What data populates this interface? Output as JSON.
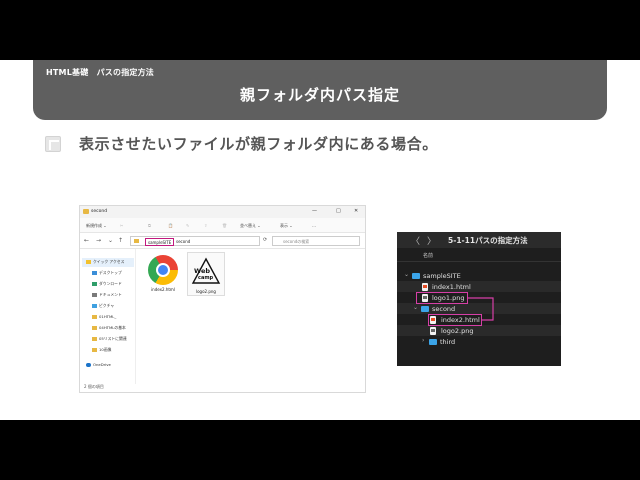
{
  "header": {
    "section": "HTML基礎　パスの指定方法",
    "title": "親フォルダ内パス指定"
  },
  "bullet": "表示させたいファイルが親フォルダ内にある場合。",
  "explorer": {
    "window_title": "second",
    "controls": [
      "—",
      "□",
      "✕"
    ],
    "commands": [
      "新規作成 ⌄",
      "並べ替え ⌄",
      "表示 ⌄",
      "…"
    ],
    "nav": [
      "←",
      "→",
      "⌄",
      "↑"
    ],
    "breadcrumb": [
      "sampleSITE",
      "second"
    ],
    "search_placeholder": "secondの検索",
    "sidebar": [
      "クイック アクセス",
      "デスクトップ",
      "ダウンロード",
      "ドキュメント",
      "ピクチャ",
      "01HTML_",
      "04HTMLの基本",
      "05リストに関連",
      "10画像",
      "OneDrive"
    ],
    "files": [
      {
        "name": "index2.html",
        "icon": "chrome-icon"
      },
      {
        "name": "logo2.png",
        "icon": "logo-image-icon",
        "logo_text": [
          "Web",
          "camp"
        ]
      }
    ],
    "status": "2 個の項目"
  },
  "mac": {
    "title": "5-1-11パスの指定方法",
    "column_header": "名前",
    "nav": [
      "〈",
      "〉"
    ],
    "rows": [
      {
        "label": "sampleSITE",
        "type": "folder",
        "expanded": true
      },
      {
        "label": "index1.html",
        "type": "html"
      },
      {
        "label": "logo1.png",
        "type": "png"
      },
      {
        "label": "second",
        "type": "folder",
        "expanded": true
      },
      {
        "label": "index2.html",
        "type": "html"
      },
      {
        "label": "logo2.png",
        "type": "png"
      },
      {
        "label": "third",
        "type": "folder",
        "expanded": false
      }
    ]
  },
  "colors": {
    "header_bg": "#5f5f5f",
    "highlight": "#d63fa7",
    "folder_blue": "#3ba4e8",
    "folder_yellow": "#e7b843"
  }
}
